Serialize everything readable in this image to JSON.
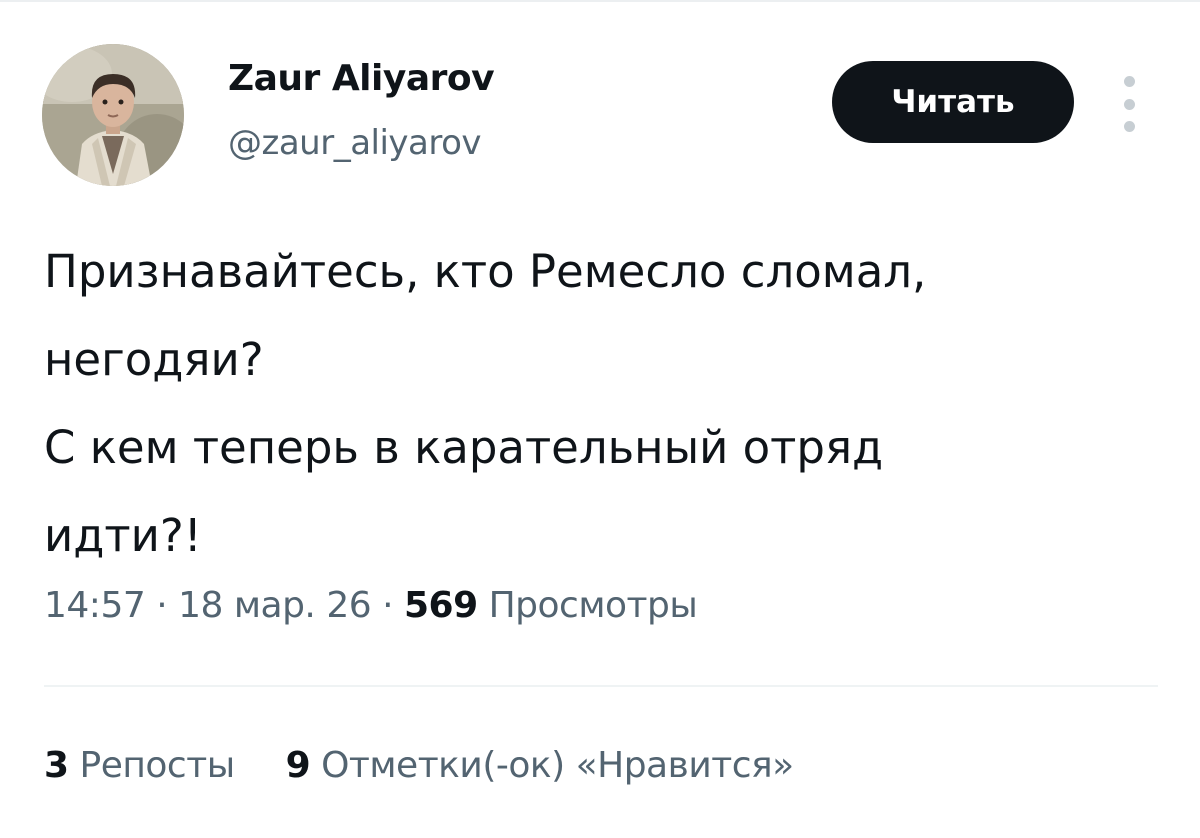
{
  "author": {
    "display_name": "Zaur Aliyarov",
    "handle": "@zaur_aliyarov"
  },
  "follow_button": {
    "label": "Читать"
  },
  "tweet": {
    "lines": [
      "Признавайтесь, кто Ремесло сломал,",
      "негодяи?",
      "С кем теперь в карательный отряд",
      "идти?!"
    ]
  },
  "meta": {
    "time": "14:57",
    "separator": "·",
    "date": "18 мар. 26",
    "views_count": "569",
    "views_label": "Просмотры"
  },
  "stats": {
    "reposts_count": "3",
    "reposts_label": "Репосты",
    "likes_count": "9",
    "likes_label": "Отметки(-ок) «Нравится»"
  },
  "colors": {
    "text": "#0f1419",
    "secondary_text": "#536471",
    "button_bg": "#0f1419",
    "button_text": "#ffffff",
    "divider": "#eff3f4"
  },
  "icons": {
    "more": "more-vertical-icon"
  }
}
